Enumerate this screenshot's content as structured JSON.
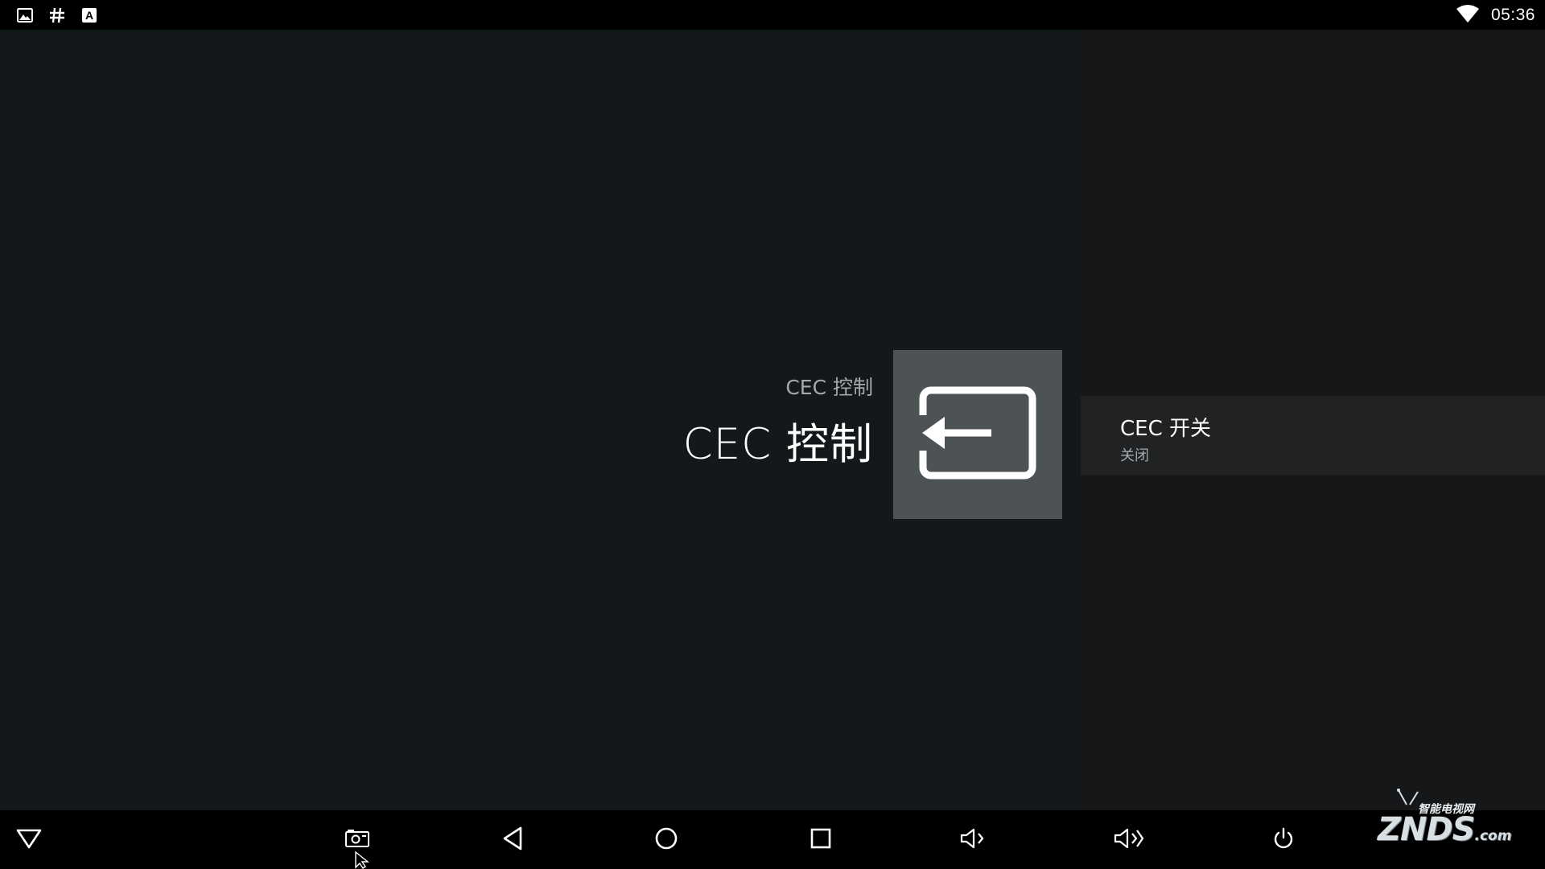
{
  "status_bar": {
    "left_icons": [
      "image-icon",
      "hash-icon",
      "keyboard-icon"
    ],
    "wifi": "wifi-icon",
    "time": "05:36"
  },
  "header": {
    "breadcrumb": "CEC 控制",
    "title": "CEC 控制",
    "icon": "exit-to-app-icon"
  },
  "preferences": [
    {
      "title": "CEC 开关",
      "summary": "关闭"
    }
  ],
  "nav_bar": {
    "buttons": [
      "hide-bar",
      "screenshot",
      "back",
      "home",
      "recents",
      "volume-down",
      "volume-up",
      "power"
    ]
  },
  "watermark": {
    "tagline": "智能电视网",
    "brand": "ZNDS",
    "suffix": ".com"
  },
  "colors": {
    "background": "#13181b",
    "right_pane": "#161719",
    "selected_item": "#202224",
    "icon_tile": "#4d5255",
    "bars": "#000000"
  }
}
